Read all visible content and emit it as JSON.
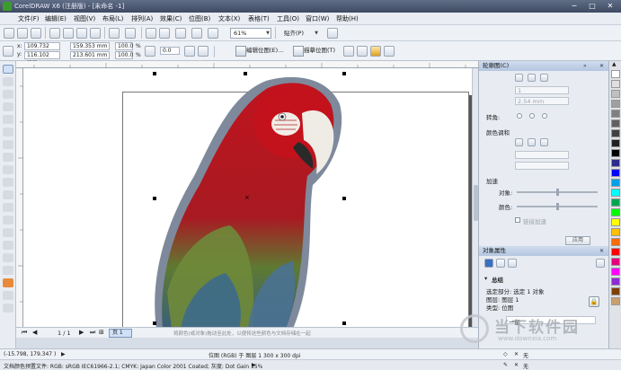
{
  "window": {
    "title": "CorelDRAW X6 (注册版) - [未命名 -1]",
    "minimize": "─",
    "maximize": "□",
    "close": "✕"
  },
  "menubar": {
    "items": [
      "文件(F)",
      "编辑(E)",
      "视图(V)",
      "布局(L)",
      "排列(A)",
      "效果(C)",
      "位图(B)",
      "文本(X)",
      "表格(T)",
      "工具(O)",
      "窗口(W)",
      "帮助(H)"
    ]
  },
  "toolbar": {
    "zoom_value": "61%",
    "snap_label": "贴齐(P)"
  },
  "property_bar": {
    "x_label": "x:",
    "x_value": "109.732 mm",
    "y_label": "y:",
    "y_value": "116.102 mm",
    "width_value": "159.353 mm",
    "height_value": "213.601 mm",
    "scale_x": "100.0",
    "scale_y": "100.0",
    "percent": "%",
    "rotation": "0.0",
    "edit_bitmap": "编辑位图(E)...",
    "trace_bitmap": "描摹位图(T)"
  },
  "docker": {
    "outline_title": "轮廓图(C)",
    "outline_steps": "1",
    "outline_offset": "2.54 mm",
    "corner_label": "转角:",
    "color_blend_label": "颜色调和",
    "accelerate_label": "加速",
    "object_label": "对象:",
    "color_label": "颜色:",
    "link_accel_label": "链接加速",
    "apply_button": "应用",
    "object_props_title": "对象属性",
    "summary_label": "总结",
    "selection_row": "选定部分: 选定 1 对象",
    "layer_row": "图层:   图层 1",
    "type_row": "类型:   位图",
    "bottom_combo": "一般"
  },
  "canvas_nav": {
    "page_counter": "1 / 1",
    "page_tab": "页 1",
    "hint": "将颜色(或对象)拖动至此处，以便将这些颜色与文档存储在一起"
  },
  "status": {
    "coords": "(-15.798, 179.347 )",
    "object_info": "位图 (RGB) 于 图层 1 300 x 300 dpi",
    "profile": "文档颜色预置文件: RGB: sRGB IEC61966-2.1; CMYK: Japan Color 2001 Coated; 灰度: Dot Gain 15%",
    "fill_none": "无",
    "outline_none": "无"
  },
  "watermark": {
    "title": "当下软件园",
    "url": "www.downxia.com"
  },
  "palette_colors": [
    "#ffffff",
    "#e0e0e0",
    "#c0c0c0",
    "#a0a0a0",
    "#808080",
    "#606060",
    "#404040",
    "#202020",
    "#000000",
    "#2b2b8c",
    "#0000ff",
    "#00a0e6",
    "#00ffff",
    "#00a651",
    "#00ff00",
    "#ffff00",
    "#ffc000",
    "#ff6a00",
    "#ff0000",
    "#e6007e",
    "#ff00ff",
    "#8c2bd4",
    "#7f3f00",
    "#c8a070"
  ]
}
